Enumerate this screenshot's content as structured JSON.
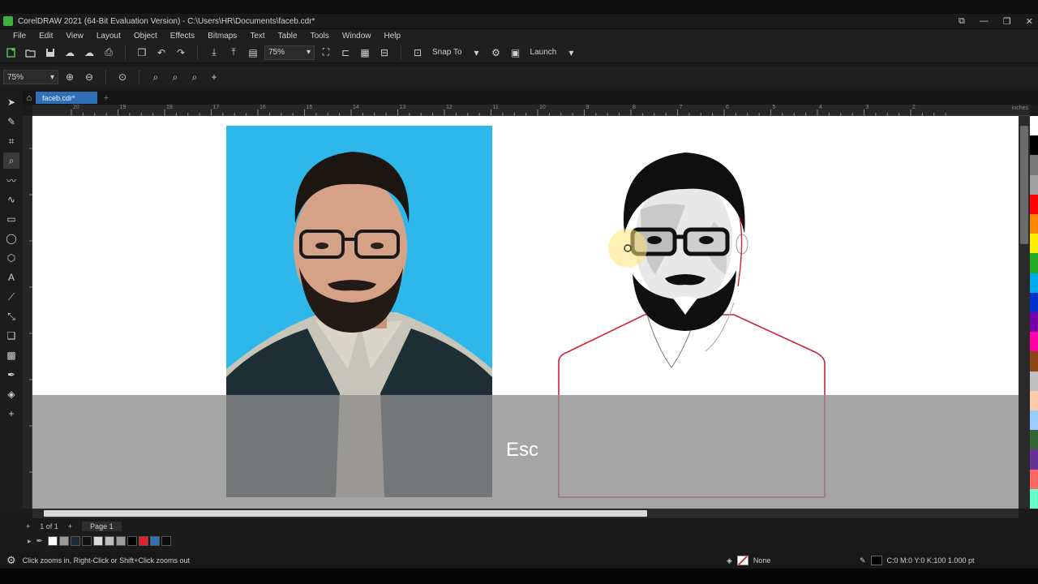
{
  "window": {
    "title": "CorelDRAW 2021 (64-Bit Evaluation Version) - C:\\Users\\HR\\Documents\\faceb.cdr*",
    "controls": [
      "⧉",
      "—",
      "❐",
      "✕"
    ]
  },
  "menu": [
    "File",
    "Edit",
    "View",
    "Layout",
    "Object",
    "Effects",
    "Bitmaps",
    "Text",
    "Table",
    "Tools",
    "Window",
    "Help"
  ],
  "toolbar": {
    "zoom_value": "75%",
    "snap_to_label": "Snap To",
    "launch_label": "Launch"
  },
  "property_bar": {
    "zoom_value": "75%"
  },
  "document_tab": {
    "name": "faceb.cdr*"
  },
  "ruler": {
    "unit": "inches",
    "ticks": [
      "20",
      "19",
      "18",
      "17",
      "16",
      "15",
      "14",
      "13",
      "12",
      "11",
      "10",
      "9",
      "8",
      "7",
      "6",
      "5",
      "4",
      "3",
      "2"
    ]
  },
  "canvas": {
    "overlay_key": "Esc"
  },
  "page_nav": {
    "counter": "1  of  1",
    "page_tab": "Page 1"
  },
  "status": {
    "hint": "Click zooms in, Right-Click or Shift+Click zooms out",
    "fill_label": "None",
    "outline_info": "C:0 M:0 Y:0 K:100  1.000 pt"
  },
  "colors": {
    "accent_tab": "#2f6fb5",
    "photo_background": "#2eb7ea",
    "outline_red": "#d0203a"
  },
  "color_palette": [
    "#ffffff",
    "#000000",
    "#7a7a7a",
    "#a0a0a0",
    "#ff0000",
    "#ff8800",
    "#ffee00",
    "#22aa22",
    "#00aaee",
    "#0033cc",
    "#7700aa",
    "#ff00aa",
    "#8b4513",
    "#c0c0c0",
    "#ffccaa",
    "#99ccff",
    "#336633",
    "#663399",
    "#ff6666",
    "#66ffcc"
  ],
  "doc_palette": [
    "#ffffff",
    "#9a9a9a",
    "#1c2a36",
    "#111111",
    "#dcdcdc",
    "#bdbdbd",
    "#9d9d9d",
    "#000000",
    "#e0202a",
    "#3b6fb5",
    "#0b0b0b"
  ]
}
